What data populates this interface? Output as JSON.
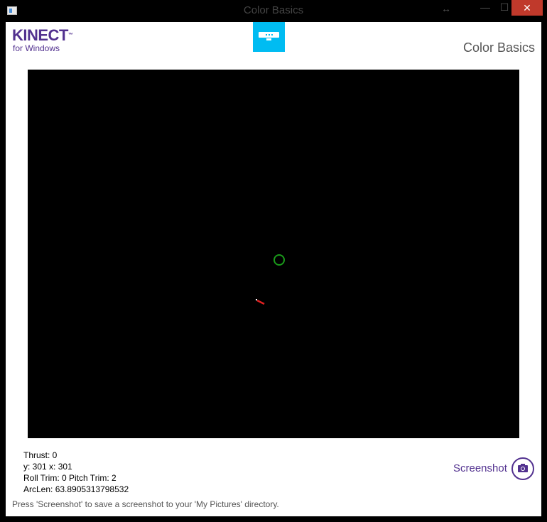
{
  "window": {
    "title": "Color Basics",
    "resize_glyph": "↔",
    "minimize_glyph": "—",
    "maximize_glyph": "☐",
    "close_glyph": "✕"
  },
  "header": {
    "logo_main": "KINECT",
    "logo_tm": "™",
    "logo_sub": "for Windows",
    "app_title": "Color Basics",
    "sensor_icon": "kinect-sensor-icon"
  },
  "color_view": {
    "target_circle_color": "#1a9a1a",
    "marker_color": "#e02020"
  },
  "status": {
    "thrust": "Thrust: 0",
    "position": "y: 301 x: 301",
    "trim": "Roll Trim: 0 Pitch Trim: 2",
    "arclen": "ArcLen: 63.8905313798532"
  },
  "screenshot": {
    "label": "Screenshot",
    "icon": "camera-icon"
  },
  "status_bar": {
    "text": "Press 'Screenshot' to save a screenshot to your 'My Pictures' directory."
  },
  "colors": {
    "brand_purple": "#52318f",
    "sensor_blue": "#00bcf2",
    "close_red": "#c0392b"
  }
}
